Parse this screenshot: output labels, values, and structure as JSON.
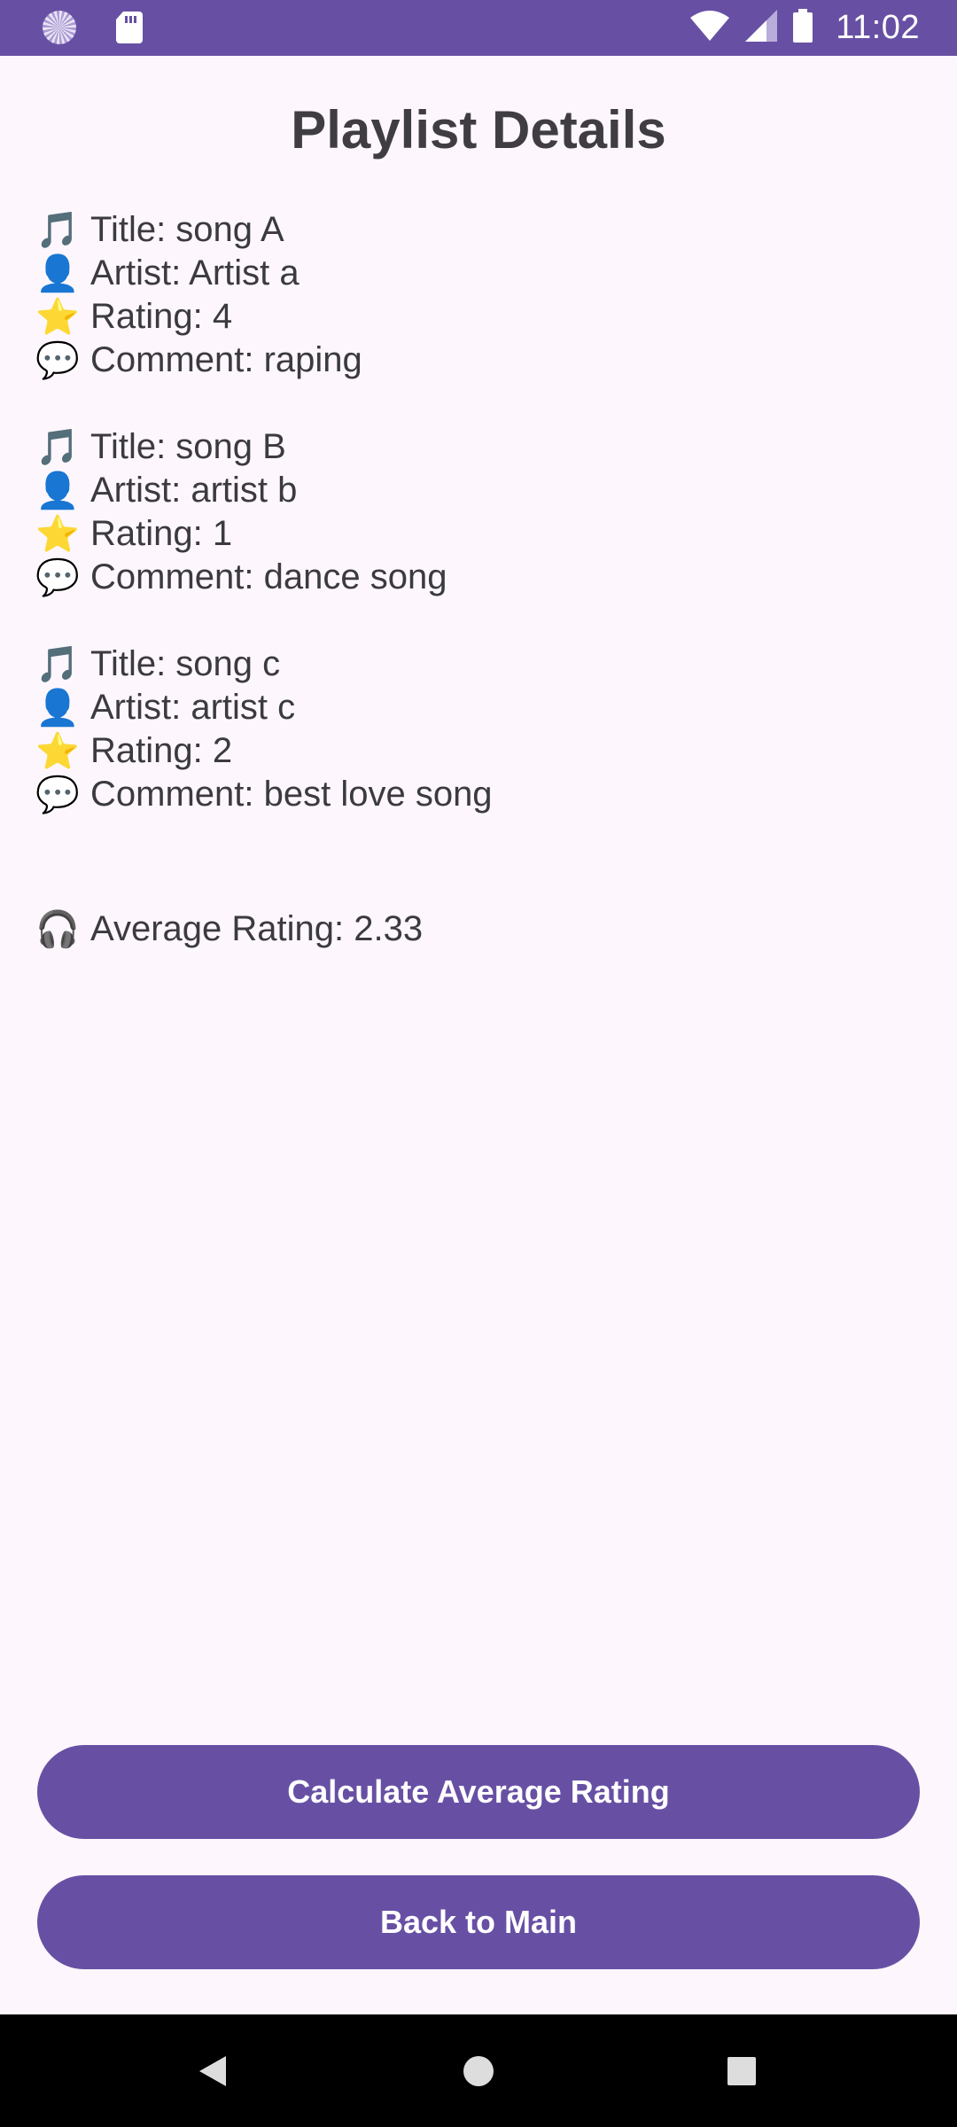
{
  "status_bar": {
    "time": "11:02",
    "color": "#6750a4",
    "icons": [
      "spinner-icon",
      "sd-card-icon",
      "wifi-icon",
      "signal-icon",
      "battery-icon"
    ]
  },
  "page": {
    "title": "Playlist Details"
  },
  "songs": [
    {
      "title": "Title: song A",
      "artist": "Artist: Artist a",
      "rating": "Rating: 4",
      "comment": "Comment: raping"
    },
    {
      "title": "Title: song B",
      "artist": "Artist: artist b",
      "rating": "Rating: 1",
      "comment": "Comment: dance song"
    },
    {
      "title": "Title: song c",
      "artist": "Artist: artist c",
      "rating": "Rating: 2",
      "comment": "Comment: best love song"
    }
  ],
  "icons": {
    "title": "🎵",
    "artist": "👤",
    "rating": "⭐",
    "comment": "💬",
    "average": "🎧"
  },
  "average": {
    "label": "Average Rating: 2.33"
  },
  "buttons": {
    "calculate_label": "Calculate Average Rating",
    "back_label": "Back to Main"
  },
  "colors": {
    "accent": "#6750a4",
    "background": "#fdf7fd",
    "text": "#3b3a3f"
  }
}
